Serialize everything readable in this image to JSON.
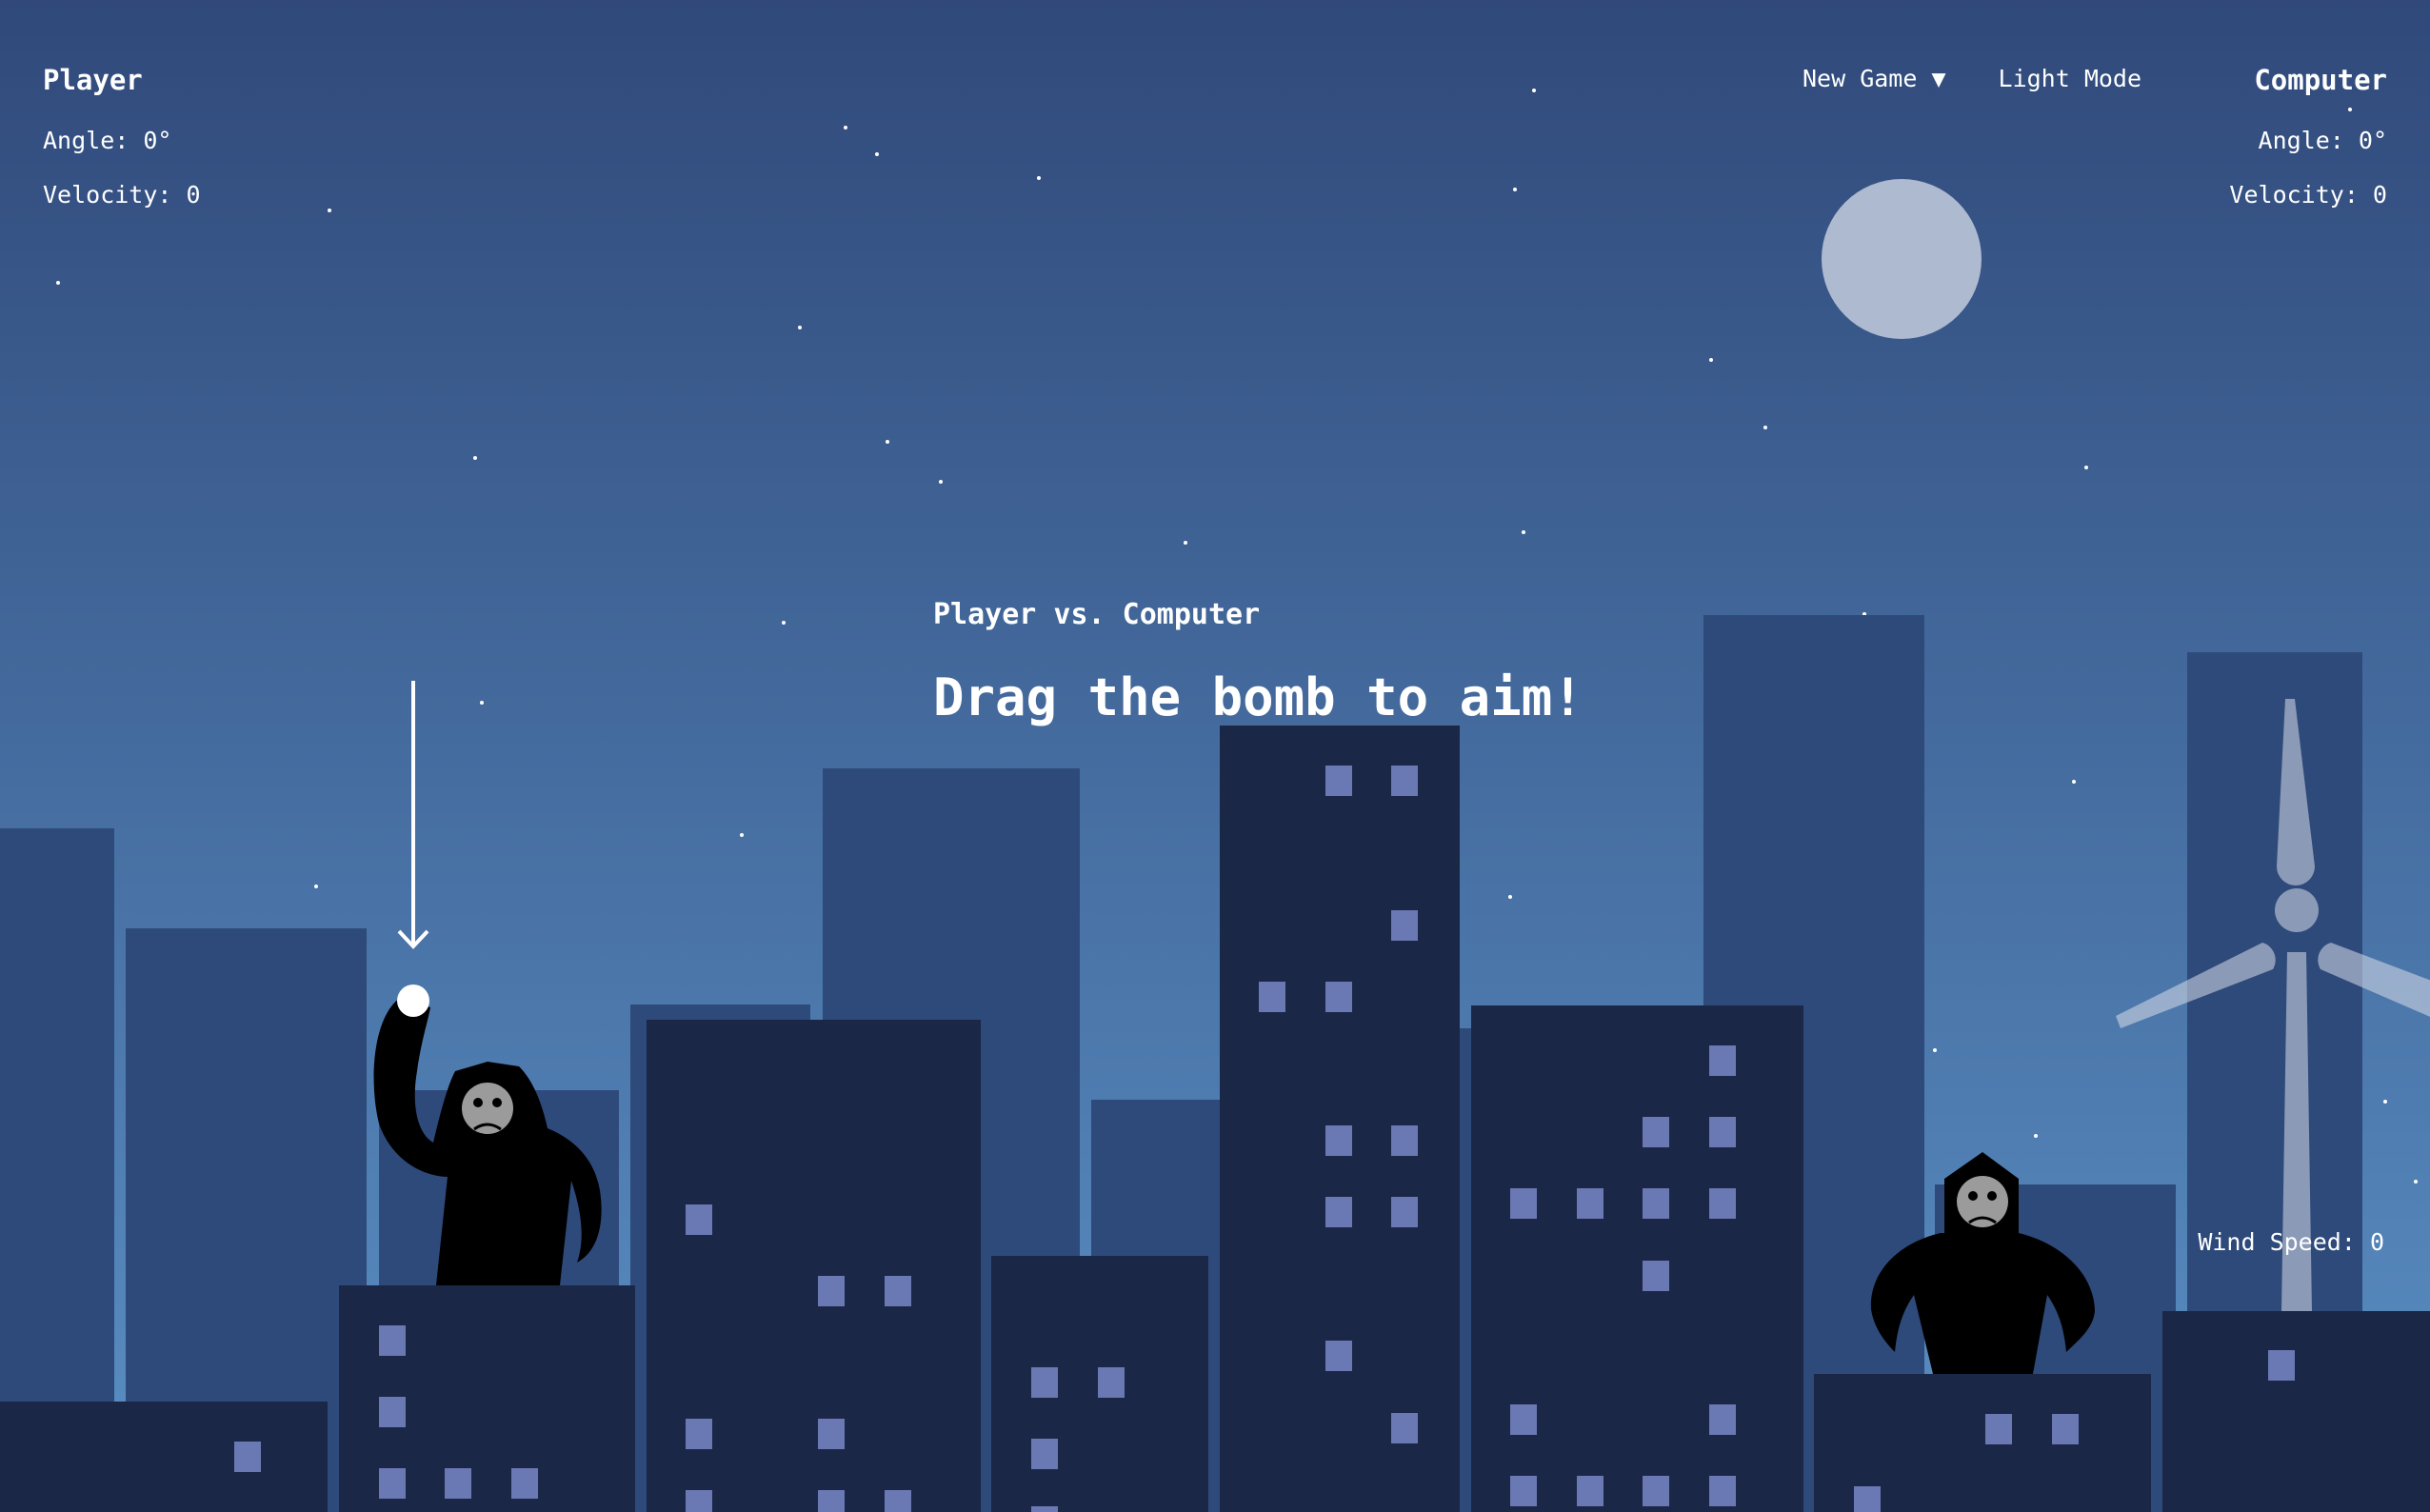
{
  "player": {
    "name": "Player",
    "angle_label": "Angle: 0°",
    "velocity_label": "Velocity: 0"
  },
  "computer": {
    "name": "Computer",
    "angle_label": "Angle: 0°",
    "velocity_label": "Velocity: 0"
  },
  "controls": {
    "new_game": "New Game ▼",
    "light_mode": "Light Mode"
  },
  "center": {
    "matchup": "Player vs. Computer",
    "instruction": "Drag the bomb to aim!"
  },
  "wind": {
    "label": "Wind Speed: 0"
  },
  "colors": {
    "sky_top": "#30497a",
    "sky_bottom": "#5a8fc4",
    "moon": "#aebad0",
    "back_building": "#2e4a7a",
    "front_building": "#1b2747",
    "window": "#6a78b4",
    "gorilla": "#000000",
    "gorilla_face": "#9b9b9b",
    "windmill": "#d8dde8"
  },
  "icons": {
    "moon": "moon-icon",
    "bomb": "bomb-icon",
    "aim_arrow": "aim-arrow-icon",
    "windmill": "windmill-icon",
    "player_gorilla": "gorilla-icon",
    "computer_gorilla": "gorilla-icon"
  }
}
